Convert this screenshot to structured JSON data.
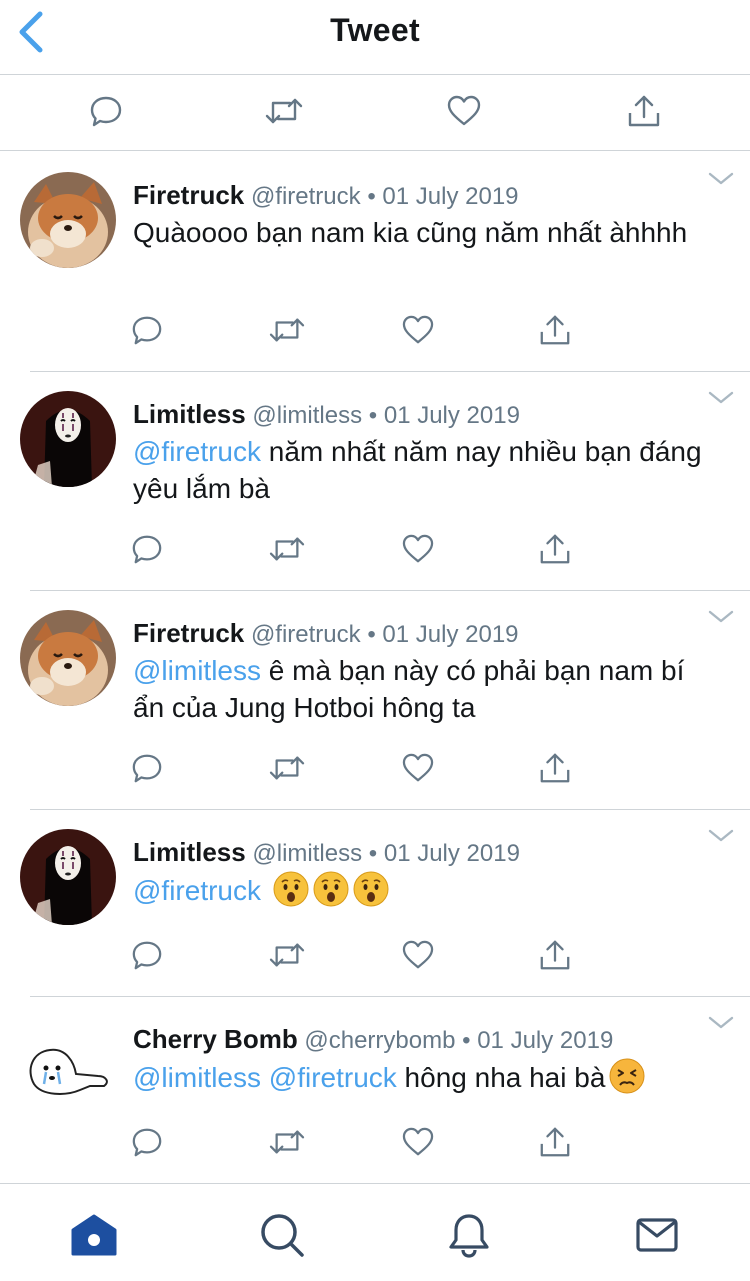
{
  "header": {
    "title": "Tweet"
  },
  "colors": {
    "accent": "#4aa1eb",
    "icon": "#657786",
    "tabActive": "#1d4fa0",
    "tabIcon": "#374b63",
    "divider": "#cfd4d8"
  },
  "tweets": [
    {
      "name": "Firetruck",
      "handle": "@firetruck",
      "date": "01 July 2019",
      "avatar": "shiba-dog-avatar",
      "mentions": [],
      "text": "Quàoooo bạn nam kia cũng năm nhất àhhhh",
      "emoji": []
    },
    {
      "name": "Limitless",
      "handle": "@limitless",
      "date": "01 July 2019",
      "avatar": "no-face-avatar",
      "mentions": [
        "@firetruck"
      ],
      "text": "năm nhất năm nay nhiều bạn đáng yêu lắm bà",
      "emoji": []
    },
    {
      "name": "Firetruck",
      "handle": "@firetruck",
      "date": "01 July 2019",
      "avatar": "shiba-dog-avatar",
      "mentions": [
        "@limitless"
      ],
      "text": "ê mà bạn này có phải bạn nam bí ẩn của Jung Hotboi hông ta",
      "emoji": []
    },
    {
      "name": "Limitless",
      "handle": "@limitless",
      "date": "01 July 2019",
      "avatar": "no-face-avatar",
      "mentions": [
        "@firetruck"
      ],
      "text": "",
      "emoji": [
        "astonished-face-emoji",
        "astonished-face-emoji",
        "astonished-face-emoji"
      ]
    },
    {
      "name": "Cherry Bomb",
      "handle": "@cherrybomb",
      "date": "01 July 2019",
      "avatar": "crying-seal-avatar",
      "mentions": [
        "@limitless",
        "@firetruck"
      ],
      "text": "hông nha hai bà",
      "emoji": [
        "persevering-face-emoji"
      ]
    }
  ],
  "meta_separator": "•",
  "tabs": [
    {
      "name": "home-icon",
      "active": true
    },
    {
      "name": "search-icon",
      "active": false
    },
    {
      "name": "notifications-icon",
      "active": false
    },
    {
      "name": "messages-icon",
      "active": false
    }
  ]
}
